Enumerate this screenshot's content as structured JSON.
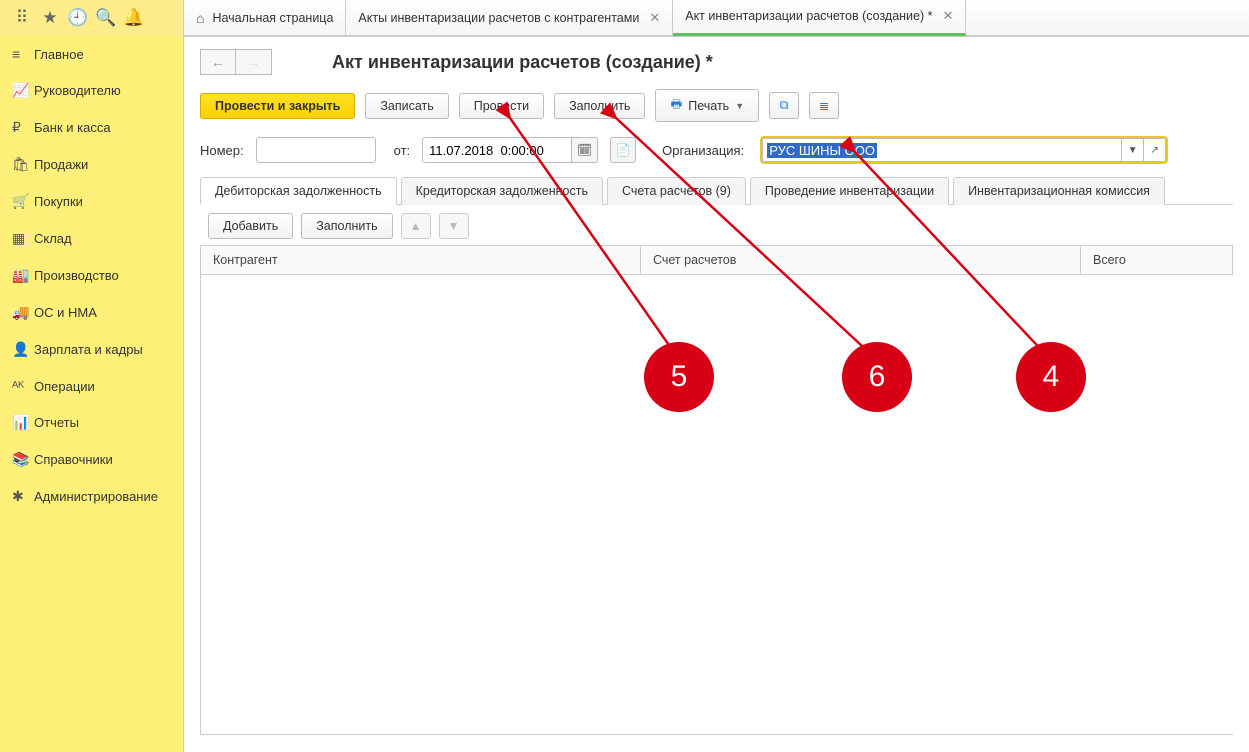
{
  "tabs": [
    {
      "label": "Начальная страница"
    },
    {
      "label": "Акты инвентаризации расчетов с контрагентами"
    },
    {
      "label": "Акт инвентаризации расчетов (создание) *"
    }
  ],
  "sidebar": {
    "items": [
      {
        "icon": "≡",
        "label": "Главное"
      },
      {
        "icon": "📈",
        "label": "Руководителю"
      },
      {
        "icon": "₽",
        "label": "Банк и касса"
      },
      {
        "icon": "🛍",
        "label": "Продажи"
      },
      {
        "icon": "🛒",
        "label": "Покупки"
      },
      {
        "icon": "▦",
        "label": "Склад"
      },
      {
        "icon": "🏭",
        "label": "Производство"
      },
      {
        "icon": "🚚",
        "label": "ОС и НМА"
      },
      {
        "icon": "👤",
        "label": "Зарплата и кадры"
      },
      {
        "icon": "ᴬᴷ",
        "label": "Операции"
      },
      {
        "icon": "📊",
        "label": "Отчеты"
      },
      {
        "icon": "📚",
        "label": "Справочники"
      },
      {
        "icon": "✱",
        "label": "Администрирование"
      }
    ]
  },
  "page": {
    "title": "Акт инвентаризации расчетов (создание) *"
  },
  "toolbar": {
    "post_close": "Провести и закрыть",
    "save": "Записать",
    "post": "Провести",
    "fill": "Заполнить",
    "print": "Печать"
  },
  "form": {
    "num_label": "Номер:",
    "num_value": "",
    "from_label": "от:",
    "date_value": "11.07.2018  0:00:00",
    "org_label": "Организация:",
    "org_value": "РУС ШИНЫ ООО"
  },
  "subtabs": [
    "Дебиторская задолженность",
    "Кредиторская задолженность",
    "Счета расчетов (9)",
    "Проведение инвентаризации",
    "Инвентаризационная комиссия"
  ],
  "inner": {
    "add": "Добавить",
    "fill": "Заполнить"
  },
  "columns": {
    "c1": "Контрагент",
    "c2": "Счет расчетов",
    "c3": "Всего"
  },
  "anno": {
    "a4": "4",
    "a5": "5",
    "a6": "6"
  }
}
